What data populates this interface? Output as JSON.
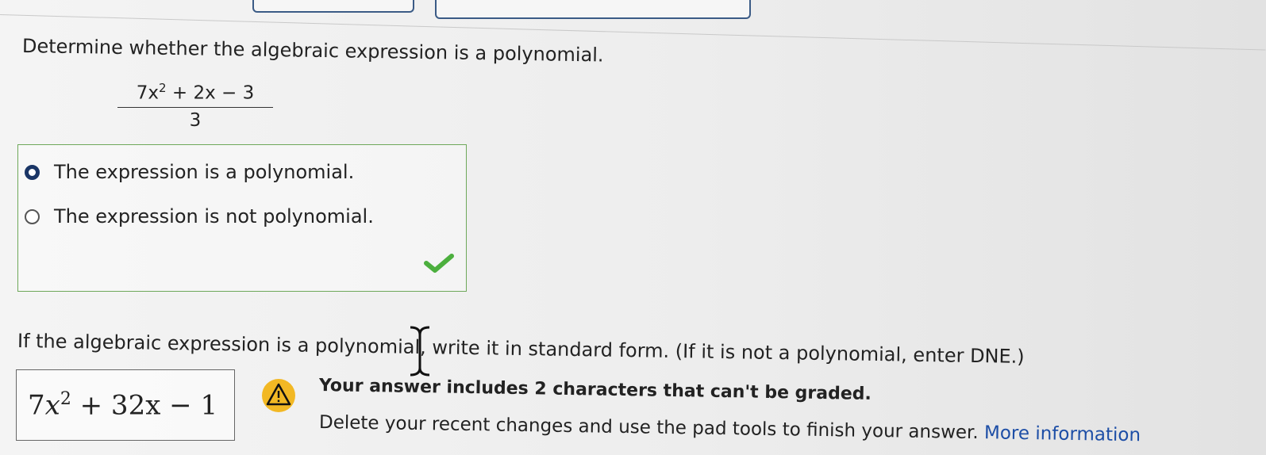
{
  "question": "Determine whether the algebraic expression is a polynomial.",
  "expression": {
    "numerator_pre": "7x",
    "numerator_exp": "2",
    "numerator_post": " + 2x − 3",
    "denominator": "3"
  },
  "options": [
    {
      "label": "The expression is a polynomial.",
      "selected": true
    },
    {
      "label": "The expression is not polynomial.",
      "selected": false
    }
  ],
  "instruction": "If the algebraic expression is a polynomial, write it in standard form. (If it is not a polynomial, enter DNE.)",
  "answer": {
    "coef": "7",
    "var": "x",
    "exp": "2",
    "rest": "+ 32x − 1"
  },
  "warning": {
    "title": "Your answer includes 2 characters that can't be graded.",
    "body": "Delete your recent changes and use the pad tools to finish your answer.",
    "link": "More information"
  },
  "colors": {
    "check": "#4caf3e",
    "warning": "#f2b824",
    "link": "#1d4ea6",
    "radio_selected": "#1a3566",
    "box_border": "#6ea85a"
  },
  "icons": {
    "check": "check-icon",
    "warning": "warning-icon",
    "cursor": "text-cursor-icon"
  }
}
